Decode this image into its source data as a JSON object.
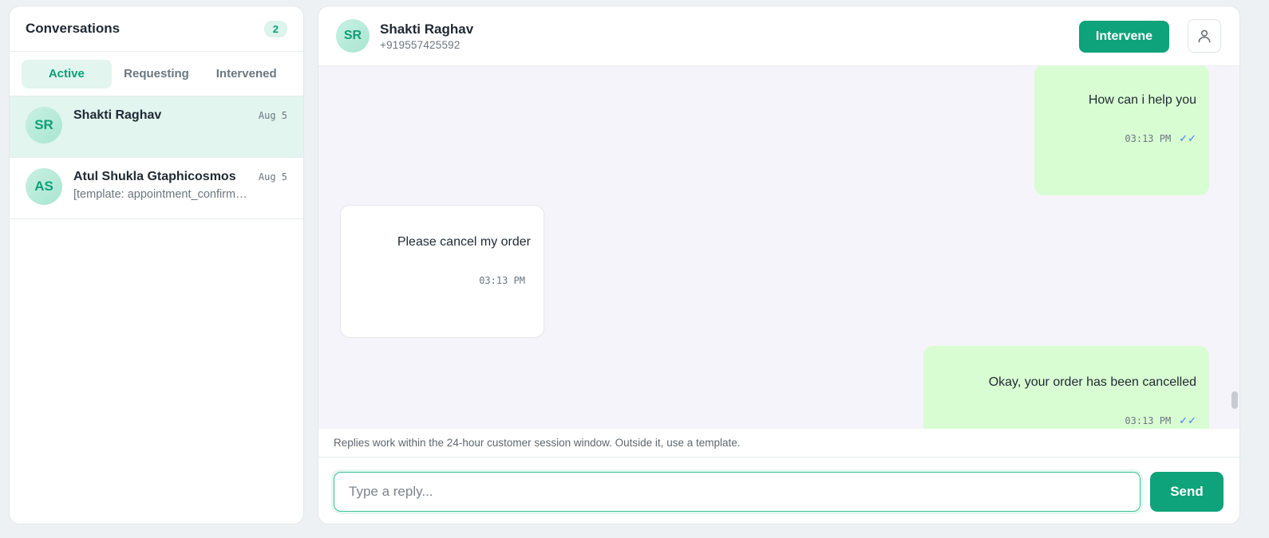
{
  "sidebar": {
    "title": "Conversations",
    "count": "2",
    "tabs": [
      {
        "label": "Active",
        "active": true
      },
      {
        "label": "Requesting",
        "active": false
      },
      {
        "label": "Intervened",
        "active": false
      }
    ],
    "conversations": [
      {
        "initials": "SR",
        "name": "Shakti Raghav",
        "preview": "",
        "date": "Aug 5",
        "selected": true
      },
      {
        "initials": "AS",
        "name": "Atul Shukla Gtaphicosmos",
        "preview": "[template: appointment_confirmation]",
        "date": "Aug 5",
        "selected": false
      }
    ]
  },
  "chat": {
    "contact": {
      "initials": "SR",
      "name": "Shakti Raghav",
      "phone": "+919557425592"
    },
    "intervene_label": "Intervene",
    "user_icon": "user-icon",
    "messages": [
      {
        "direction": "out",
        "text": "How can i help you",
        "time": "03:13 PM",
        "ticks": "✓✓"
      },
      {
        "direction": "in",
        "text": "Please cancel my order",
        "time": "03:13 PM"
      },
      {
        "direction": "out",
        "text": "Okay, your order has been cancelled",
        "time": "03:13 PM",
        "ticks": "✓✓"
      }
    ],
    "session_note": "Replies work within the 24-hour customer session window. Outside it, use a template.",
    "reply_placeholder": "Type a reply...",
    "send_label": "Send"
  },
  "colors": {
    "accent": "#0ea37a",
    "outgoing_bubble": "#d9fdd3",
    "chat_background": "#f5f4fa",
    "read_ticks": "#3b82f6"
  }
}
